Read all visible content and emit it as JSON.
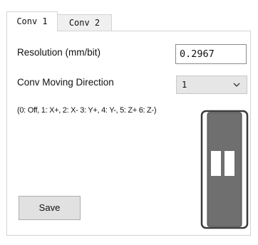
{
  "tabs": [
    {
      "label": "Conv 1",
      "active": true
    },
    {
      "label": "Conv 2",
      "active": false
    }
  ],
  "resolution": {
    "label": "Resolution (mm/bit)",
    "value": "0.2967"
  },
  "direction": {
    "label": "Conv Moving Direction",
    "selected": "1",
    "hint": "(0: Off, 1: X+, 2: X- 3: Y+, 4: Y-, 5: Z+ 6: Z-)"
  },
  "save_label": "Save",
  "icons": {
    "dropdown": "chevron-down-icon",
    "toggle": "vertical-switch-icon"
  },
  "colors": {
    "switch_body": "#6f6f6f",
    "switch_border": "#3a3a3a",
    "button_bg": "#e1e1e1"
  }
}
